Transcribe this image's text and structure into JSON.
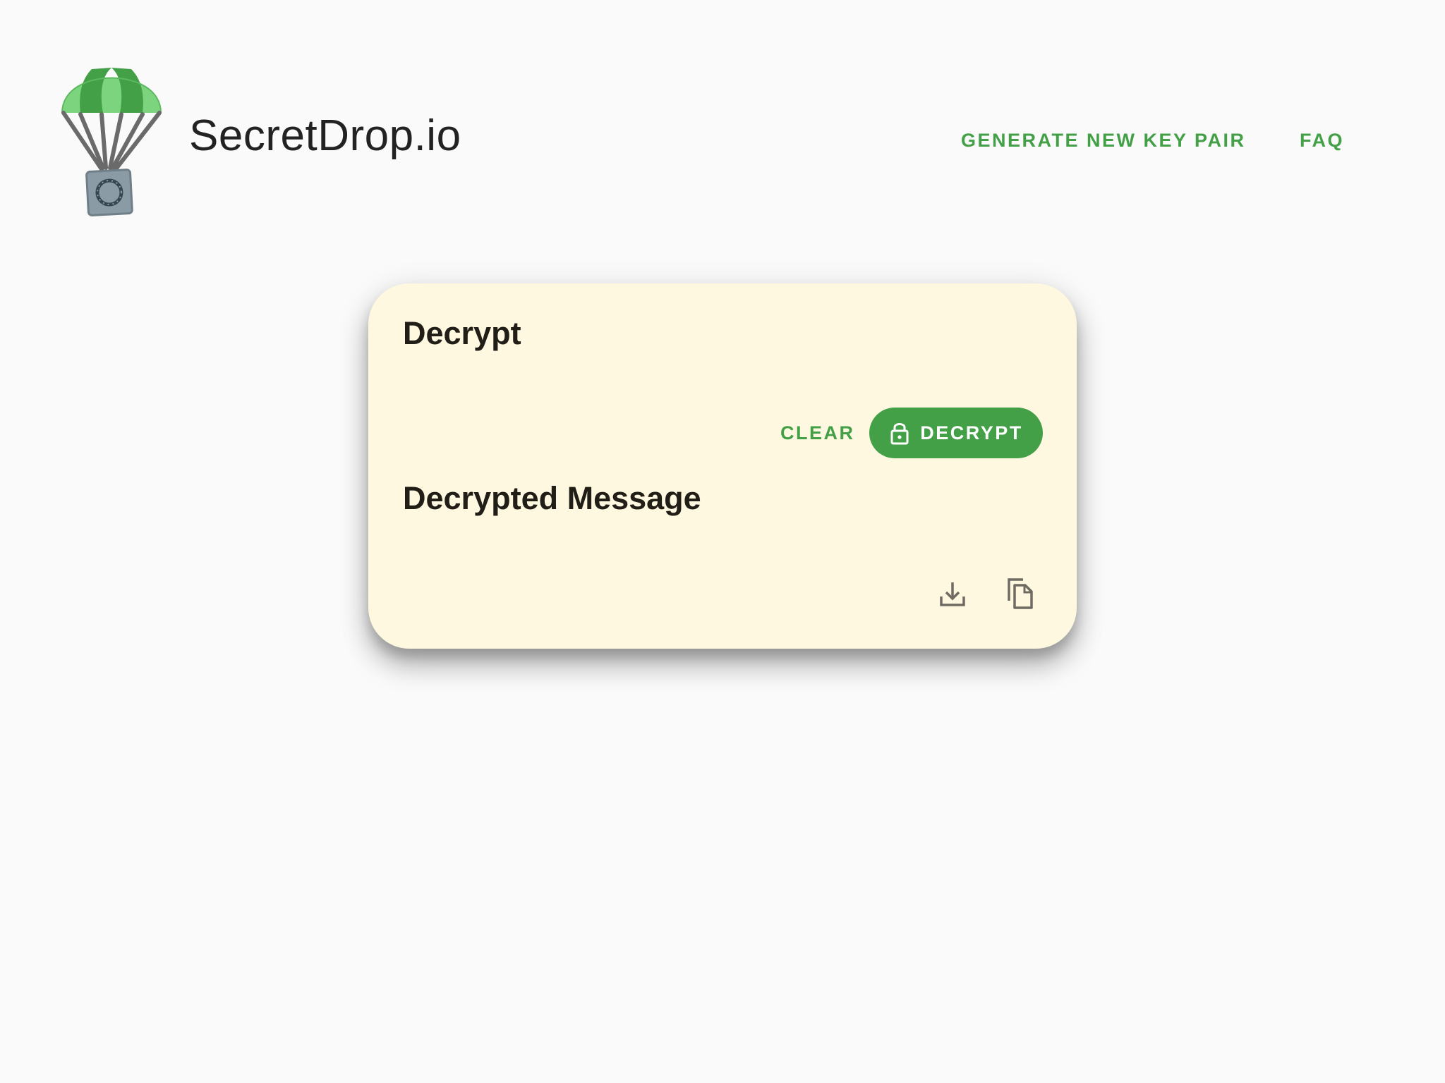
{
  "header": {
    "brand_name": "SecretDrop.io",
    "logo_icon": "parachute-safe-icon",
    "nav": [
      {
        "label": "GENERATE NEW KEY PAIR"
      },
      {
        "label": "FAQ"
      }
    ]
  },
  "card": {
    "title": "Decrypt",
    "actions": {
      "clear_label": "CLEAR",
      "decrypt_label": "DECRYPT",
      "decrypt_icon": "lock-icon"
    },
    "result_title": "Decrypted Message",
    "result_icons": [
      "download-icon",
      "copy-icon"
    ]
  },
  "colors": {
    "background": "#fafafa",
    "accent_green": "#43a047",
    "card_background": "#fff8e1",
    "text_dark": "#211d17",
    "icon_gray": "#6f6a62"
  }
}
